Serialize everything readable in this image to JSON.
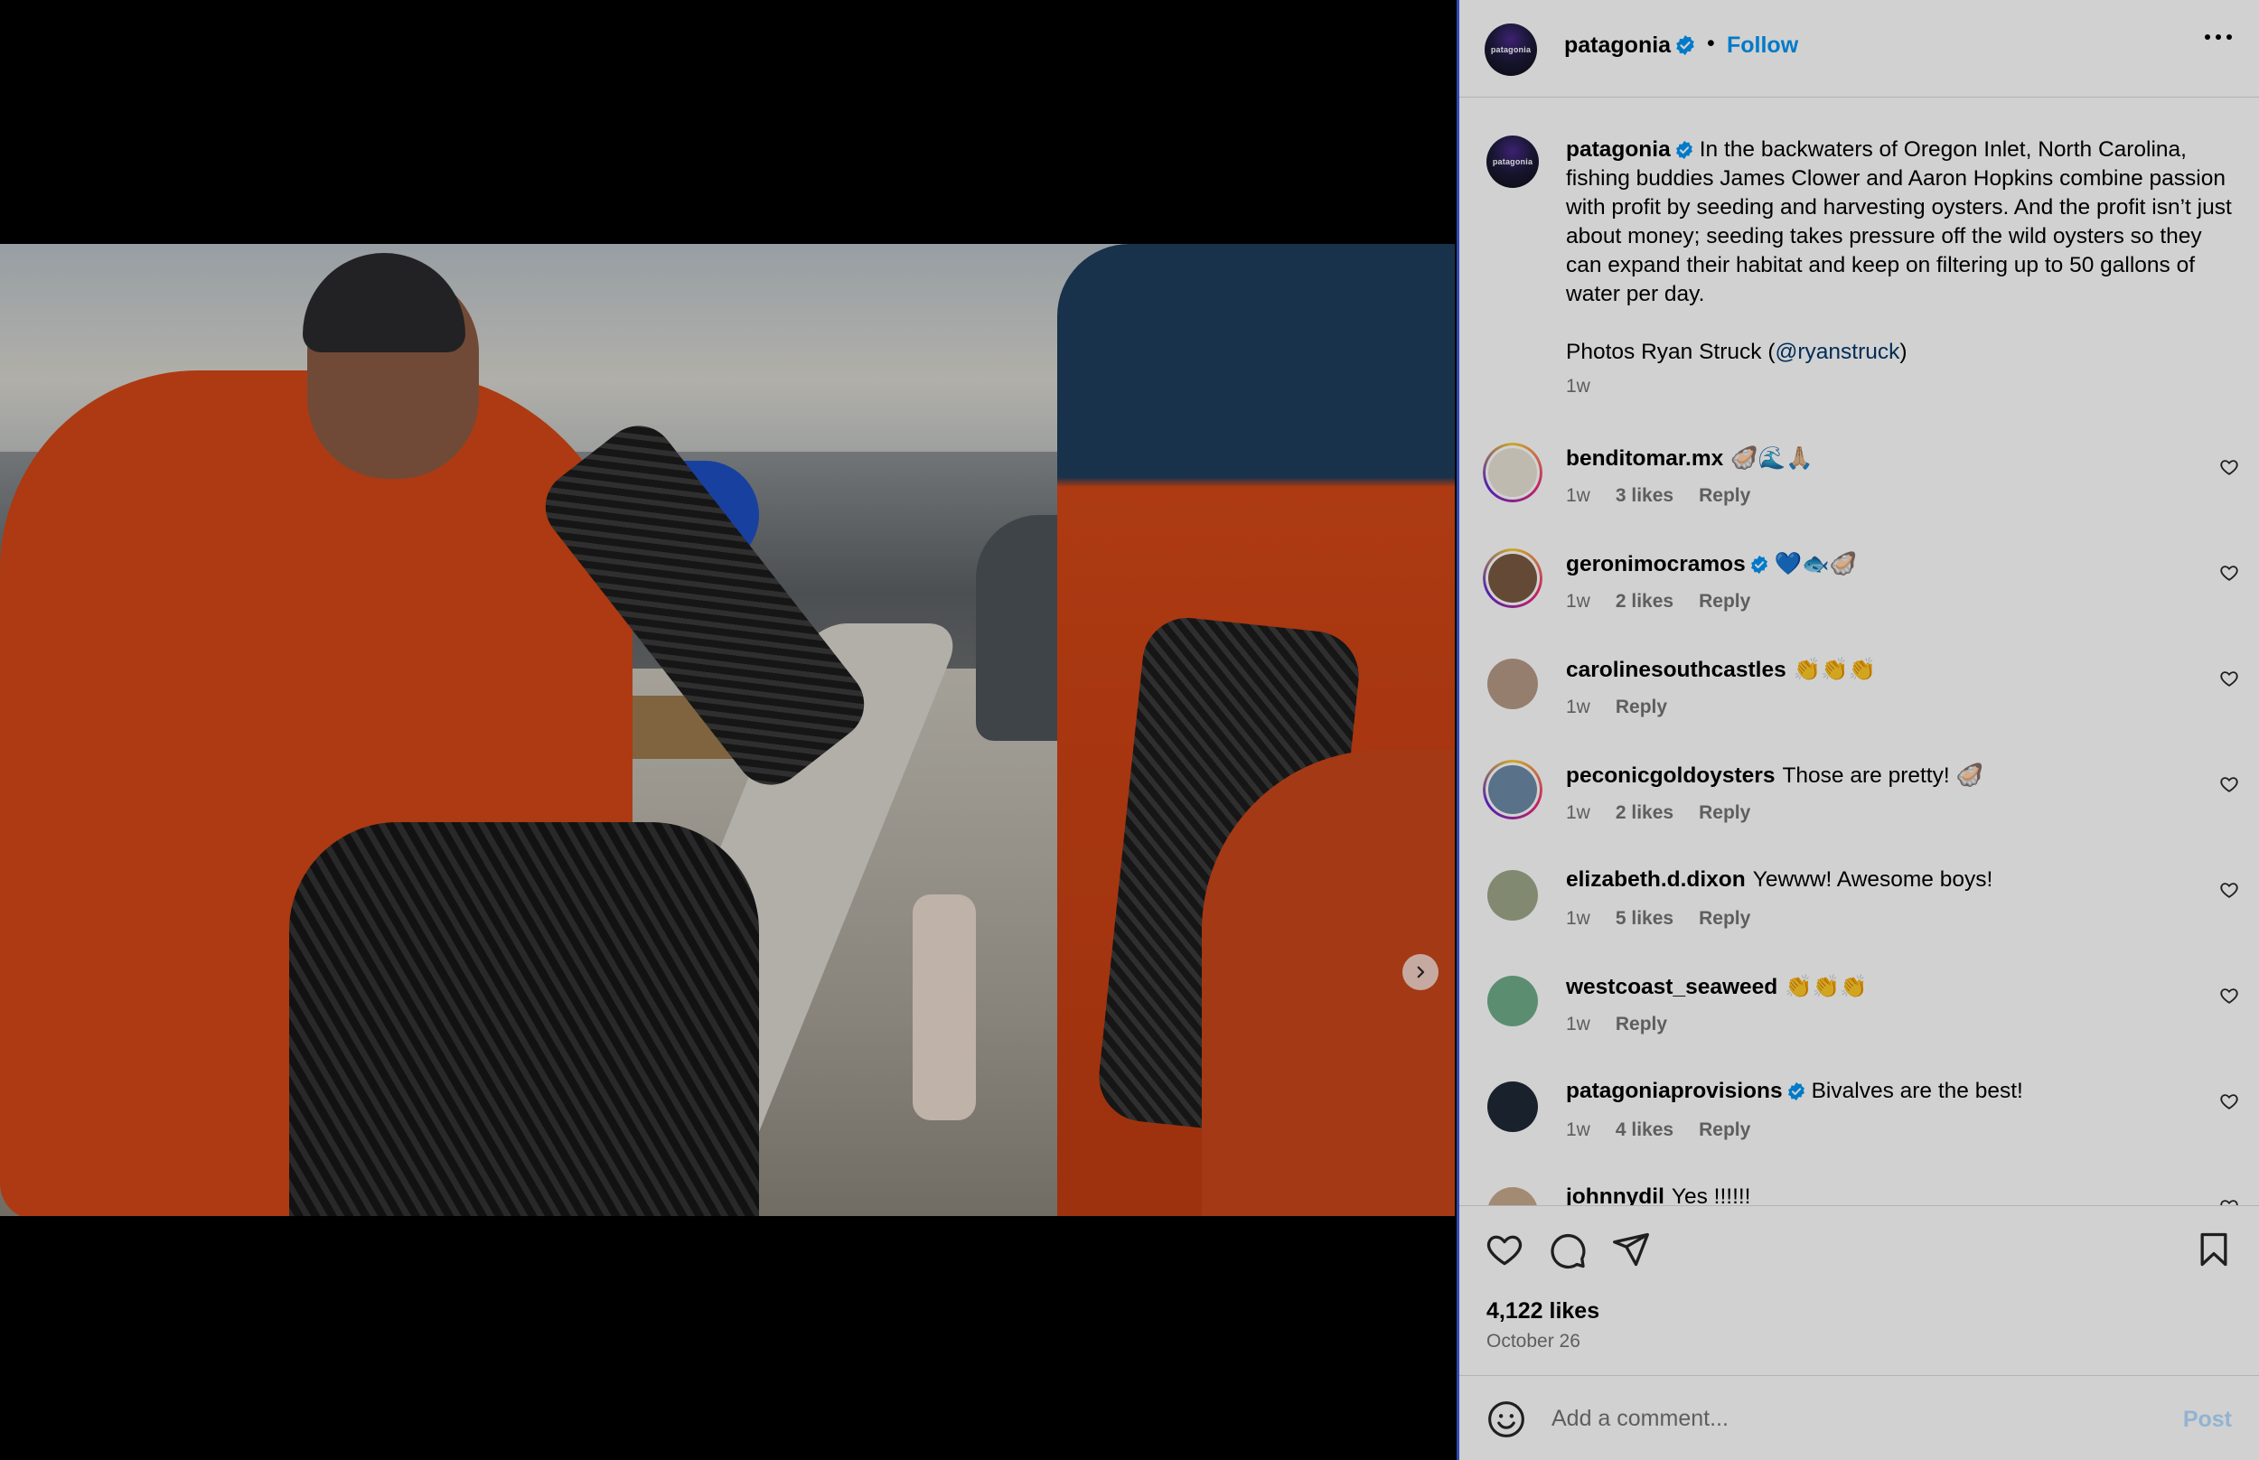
{
  "post": {
    "username": "patagonia",
    "follow_label": "Follow",
    "separator": "•",
    "avatar_text": "patagonia"
  },
  "caption": {
    "username": "patagonia",
    "text": "In the backwaters of Oregon Inlet, North Carolina, fishing buddies James Clower and Aaron Hopkins combine passion with profit by seeding and harvesting oysters. And the profit isn’t just about money; seeding takes pressure off the wild oysters so they can expand their habitat and keep on filtering up to 50 gallons of water per day.",
    "credit_prefix": "Photos Ryan Struck (",
    "credit_mention": "@ryanstruck",
    "credit_suffix": ")",
    "time": "1w"
  },
  "comments": [
    {
      "username": "benditomar.mx",
      "text": "🦪🌊🙏🏼",
      "time": "1w",
      "likes": "3 likes",
      "reply": "Reply",
      "verified": false,
      "story": true,
      "avatar_color": "#e8e3d6"
    },
    {
      "username": "geronimocramos",
      "text": "💙🐟🦪",
      "time": "1w",
      "likes": "2 likes",
      "reply": "Reply",
      "verified": true,
      "story": true,
      "avatar_color": "#7a5a44"
    },
    {
      "username": "carolinesouthcastles",
      "text": "👏👏👏",
      "time": "1w",
      "likes": "",
      "reply": "Reply",
      "verified": false,
      "story": false,
      "avatar_color": "#b89a88"
    },
    {
      "username": "peconicgoldoysters",
      "text": "Those are pretty! 🦪",
      "time": "1w",
      "likes": "2 likes",
      "reply": "Reply",
      "verified": false,
      "story": true,
      "avatar_color": "#6d8aa8"
    },
    {
      "username": "elizabeth.d.dixon",
      "text": "Yewww! Awesome boys!",
      "time": "1w",
      "likes": "5 likes",
      "reply": "Reply",
      "verified": false,
      "story": false,
      "avatar_color": "#9fa88a"
    },
    {
      "username": "westcoast_seaweed",
      "text": "👏👏👏",
      "time": "1w",
      "likes": "",
      "reply": "Reply",
      "verified": false,
      "story": false,
      "avatar_color": "#6fae8a"
    },
    {
      "username": "patagoniaprovisions",
      "text": "Bivalves are the best!",
      "time": "1w",
      "likes": "4 likes",
      "reply": "Reply",
      "verified": true,
      "story": false,
      "avatar_color": "#1f2a36"
    },
    {
      "username": "johnnydil",
      "text": "Yes !!!!!!",
      "time": "",
      "likes": "",
      "reply": "",
      "verified": false,
      "story": false,
      "avatar_color": "#c7a98c"
    }
  ],
  "actions": {
    "likes": "4,122 likes",
    "date": "October 26"
  },
  "comment_bar": {
    "placeholder": "Add a comment...",
    "post_label": "Post"
  },
  "carousel": {
    "total": 4,
    "active_index": 0
  },
  "colors": {
    "accent": "#0095f6",
    "verified": "#0095f6",
    "panel_border": "#3b5bdb"
  }
}
